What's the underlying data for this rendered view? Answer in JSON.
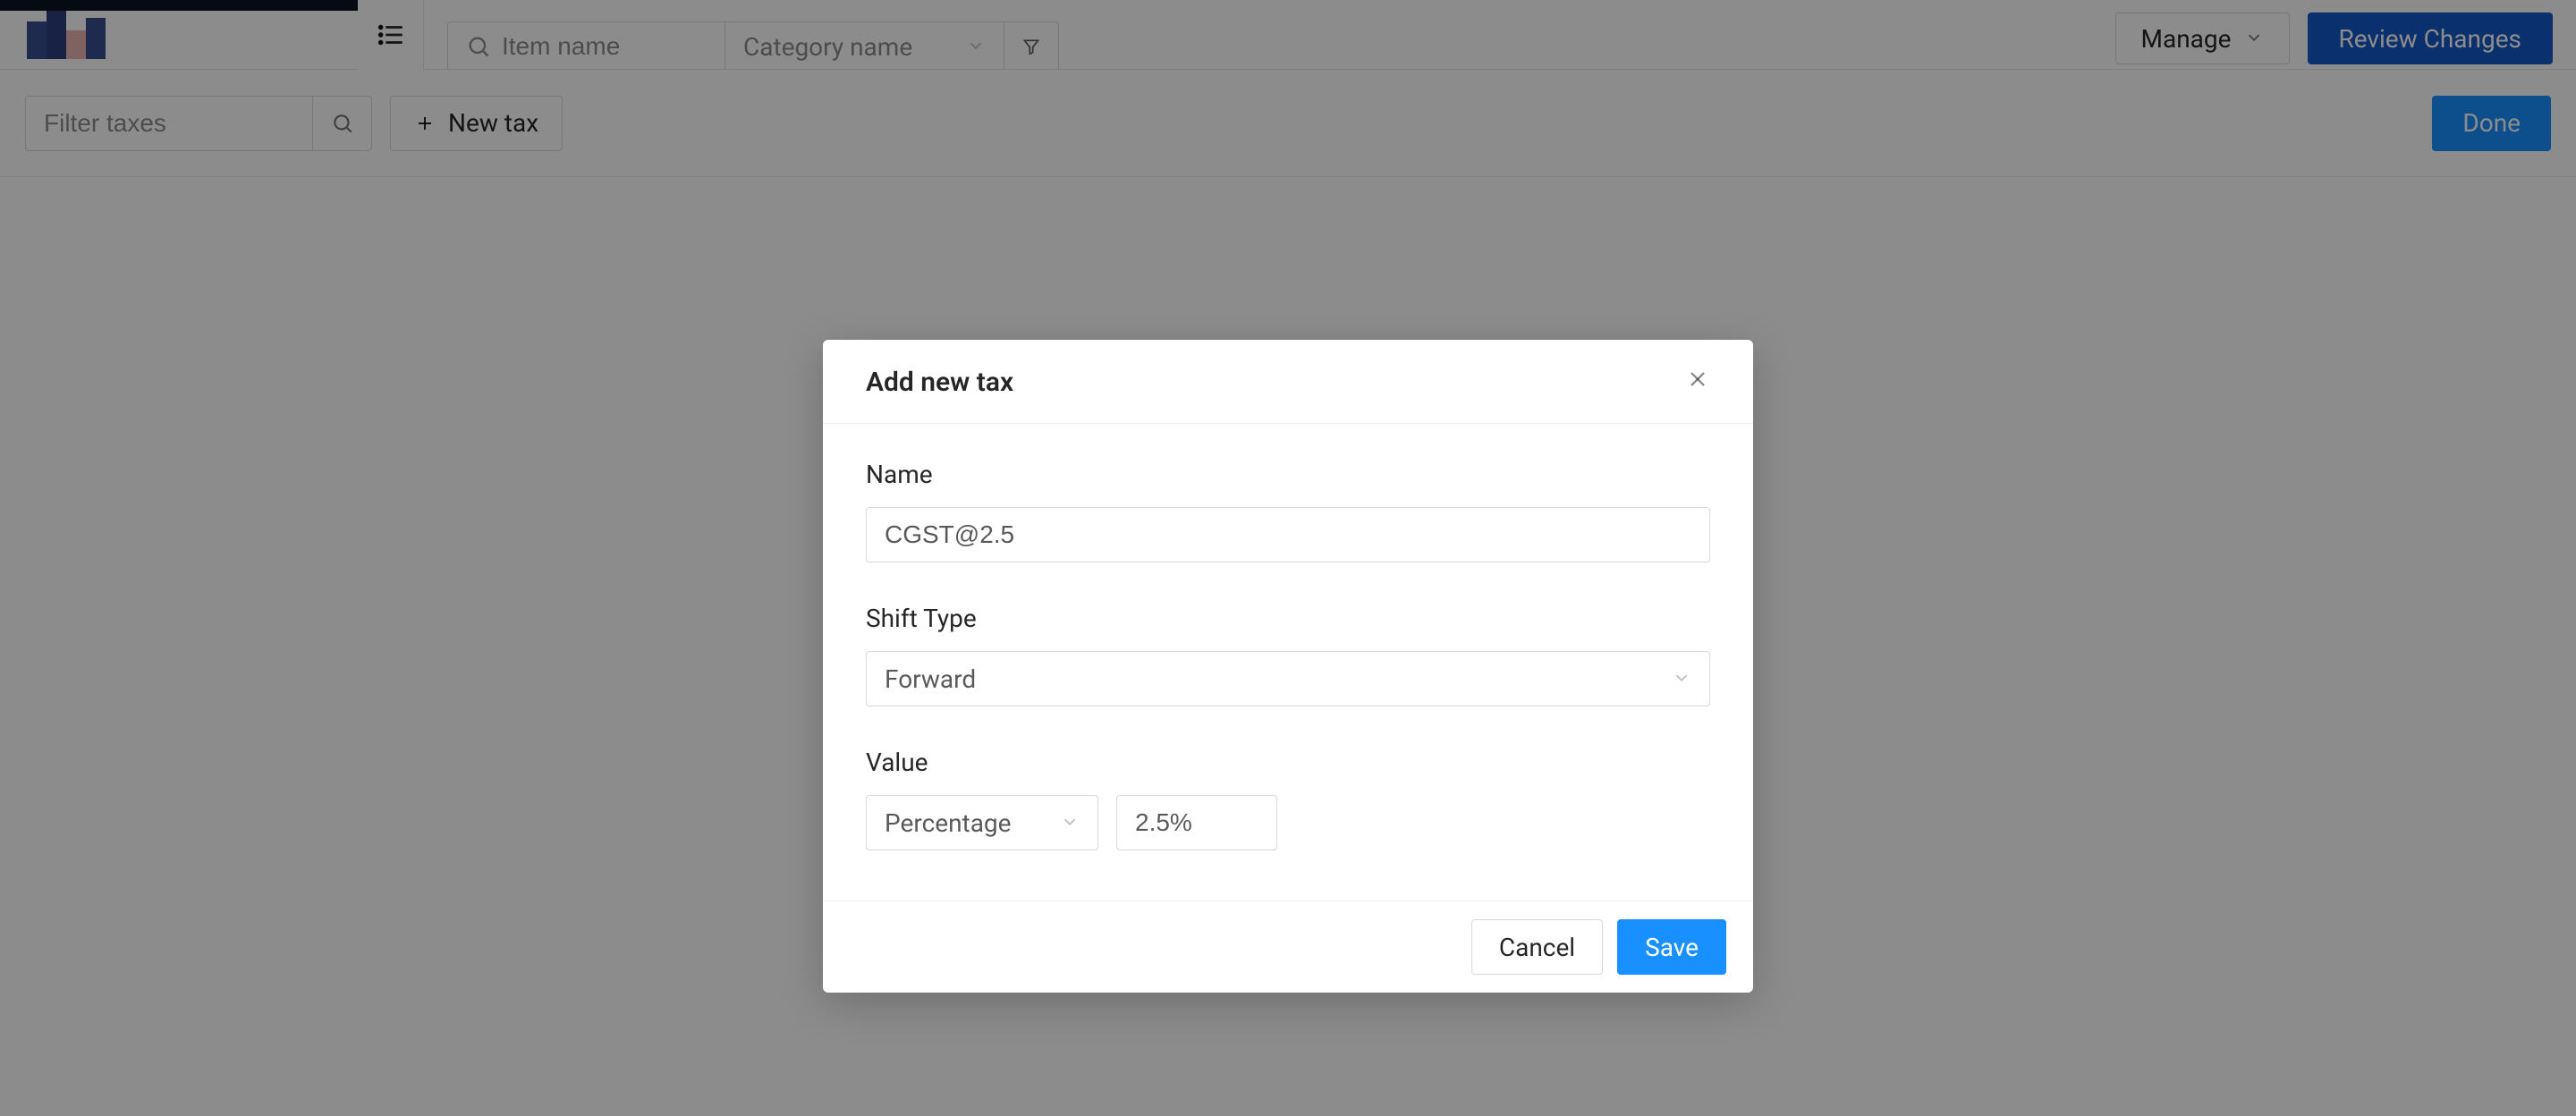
{
  "topnav": {
    "item_search_placeholder": "Item name",
    "category_placeholder": "Category name",
    "manage_label": "Manage",
    "review_label": "Review Changes"
  },
  "subbar": {
    "filter_placeholder": "Filter taxes",
    "new_tax_label": "New tax",
    "done_label": "Done"
  },
  "modal": {
    "title": "Add new tax",
    "fields": {
      "name_label": "Name",
      "name_value": "CGST@2.5",
      "shift_label": "Shift Type",
      "shift_value": "Forward",
      "value_label": "Value",
      "value_type": "Percentage",
      "value_amount": "2.5%"
    },
    "cancel_label": "Cancel",
    "save_label": "Save"
  }
}
